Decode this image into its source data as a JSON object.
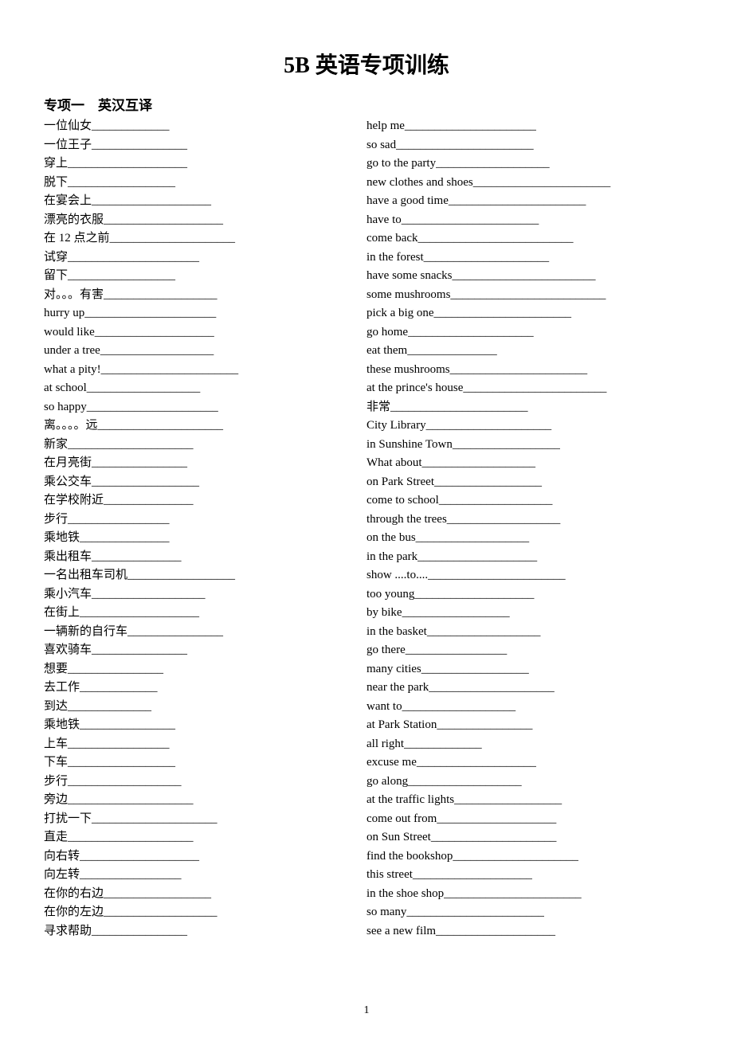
{
  "title": "5B 英语专项训练",
  "section_header": "专项一 英汉互译",
  "page_number": "1",
  "left": [
    "一位仙女_____________",
    "一位王子________________",
    "穿上____________________",
    "脱下__________________",
    "在宴会上____________________",
    "漂亮的衣服____________________",
    "在 12 点之前_____________________",
    "试穿______________________",
    "留下__________________",
    "对。。。有害___________________",
    "hurry up______________________",
    "would like____________________",
    "under a tree___________________",
    "what a pity!_______________________",
    "at school___________________",
    "so happy______________________",
    "离。。。。远_____________________",
    "新家_____________________",
    "在月亮街________________",
    "乘公交车__________________",
    "在学校附近_______________",
    "步行_________________",
    "乘地铁_______________",
    "乘出租车_______________",
    "一名出租车司机__________________",
    "乘小汽车___________________",
    "在街上____________________",
    "一辆新的自行车________________",
    "喜欢骑车________________",
    "想要________________",
    "去工作_____________",
    "到达______________",
    "乘地铁________________",
    "上车_________________",
    "下车__________________",
    "步行___________________",
    "旁边_____________________",
    "打扰一下_____________________",
    "直走_____________________",
    "向右转____________________",
    "向左转_________________",
    "在你的右边__________________",
    "在你的左边___________________",
    "寻求帮助________________"
  ],
  "right": [
    "help me______________________",
    "so sad_______________________",
    "go to the party___________________",
    "new clothes and shoes_______________________",
    "have a good time_______________________",
    "have to_______________________",
    "come back__________________________",
    "in the forest_____________________",
    "have some snacks________________________",
    "some mushrooms__________________________",
    "pick a big one_______________________",
    "go home_____________________",
    "eat them_______________",
    "these mushrooms_______________________",
    "at the prince's house________________________",
    "非常_______________________",
    "City Library_____________________",
    "in Sunshine Town__________________",
    "What about___________________",
    "on Park Street__________________",
    "come to school___________________",
    "through the trees___________________",
    "on the bus___________________",
    "in the park____________________",
    "show ....to...._______________________",
    "too young____________________",
    "by bike__________________",
    "in the basket___________________",
    "go there_________________",
    "many cities__________________",
    "near the park_____________________",
    "want to___________________",
    "at Park Station________________",
    "all right_____________",
    "excuse me____________________",
    "go along___________________",
    "at the traffic lights__________________",
    "come out from____________________",
    "on Sun Street_____________________",
    "find the bookshop_____________________",
    " this street____________________",
    " in the shoe shop_______________________",
    " so many_______________________",
    " see a new film____________________"
  ]
}
